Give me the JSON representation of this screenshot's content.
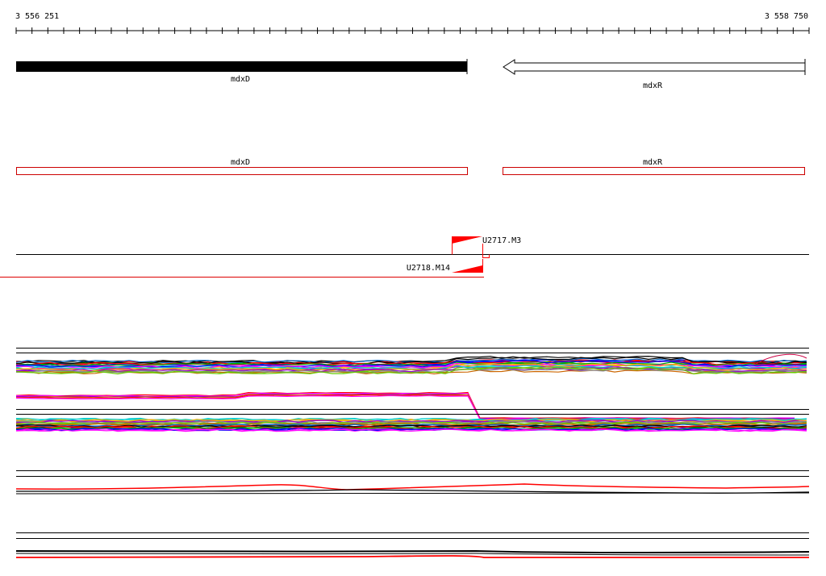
{
  "coords": {
    "start": "3 556 251",
    "end": "3 558 750"
  },
  "genes": [
    {
      "name": "mdxD",
      "strand": "+"
    },
    {
      "name": "mdxR",
      "strand": "-"
    }
  ],
  "features": [
    {
      "name": "mdxD"
    },
    {
      "name": "mdxR"
    }
  ],
  "markers": [
    {
      "name": "U2717.M3"
    },
    {
      "name": "U2718.M14"
    }
  ],
  "colors": {
    "axis": "#000000",
    "gene_fill": "#000000",
    "feature_outline": "#cc0000",
    "marker": "#ff0000",
    "track_palette": [
      "#000000",
      "#ff0000",
      "#00aa00",
      "#0000ff",
      "#ff00ff",
      "#00cccc",
      "#ffaa00",
      "#9900cc",
      "#888888",
      "#66cc00",
      "#cc6600",
      "#0066cc"
    ]
  }
}
